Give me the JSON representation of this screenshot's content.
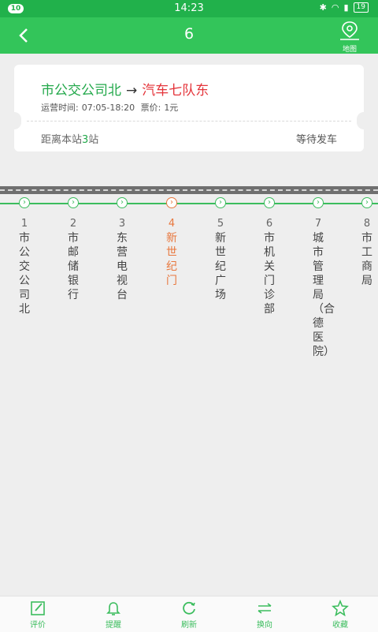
{
  "status_bar": {
    "notification_count": "10",
    "time": "14:23",
    "battery": "19"
  },
  "header": {
    "title": "6",
    "map_label": "地图"
  },
  "route": {
    "from": "市公交公司北",
    "arrow": "→",
    "to": "汽车七队东",
    "hours_label": "运营时间:",
    "hours": "07:05-18:20",
    "fare_label": "票价:",
    "fare": "1元",
    "distance_prefix": "距离本站",
    "distance_count": "3",
    "distance_suffix": "站",
    "status": "等待发车"
  },
  "stops": [
    {
      "index": "1",
      "name": "市公交公司北"
    },
    {
      "index": "2",
      "name": "市邮储银行"
    },
    {
      "index": "3",
      "name": "东营电视台"
    },
    {
      "index": "4",
      "name": "新世纪门",
      "current": true
    },
    {
      "index": "5",
      "name": "新世纪广场"
    },
    {
      "index": "6",
      "name": "市机关门诊部"
    },
    {
      "index": "7",
      "name": "城市管理局（合德医院）"
    },
    {
      "index": "8",
      "name": "市工商局"
    }
  ],
  "tabs": [
    {
      "label": "评价",
      "icon": "edit-icon"
    },
    {
      "label": "提醒",
      "icon": "bell-icon"
    },
    {
      "label": "刷新",
      "icon": "refresh-icon"
    },
    {
      "label": "换向",
      "icon": "swap-icon"
    },
    {
      "label": "收藏",
      "icon": "star-icon"
    }
  ],
  "colors": {
    "green": "#33c55a",
    "current_stop": "#e8773d",
    "destination": "#e4343a"
  }
}
